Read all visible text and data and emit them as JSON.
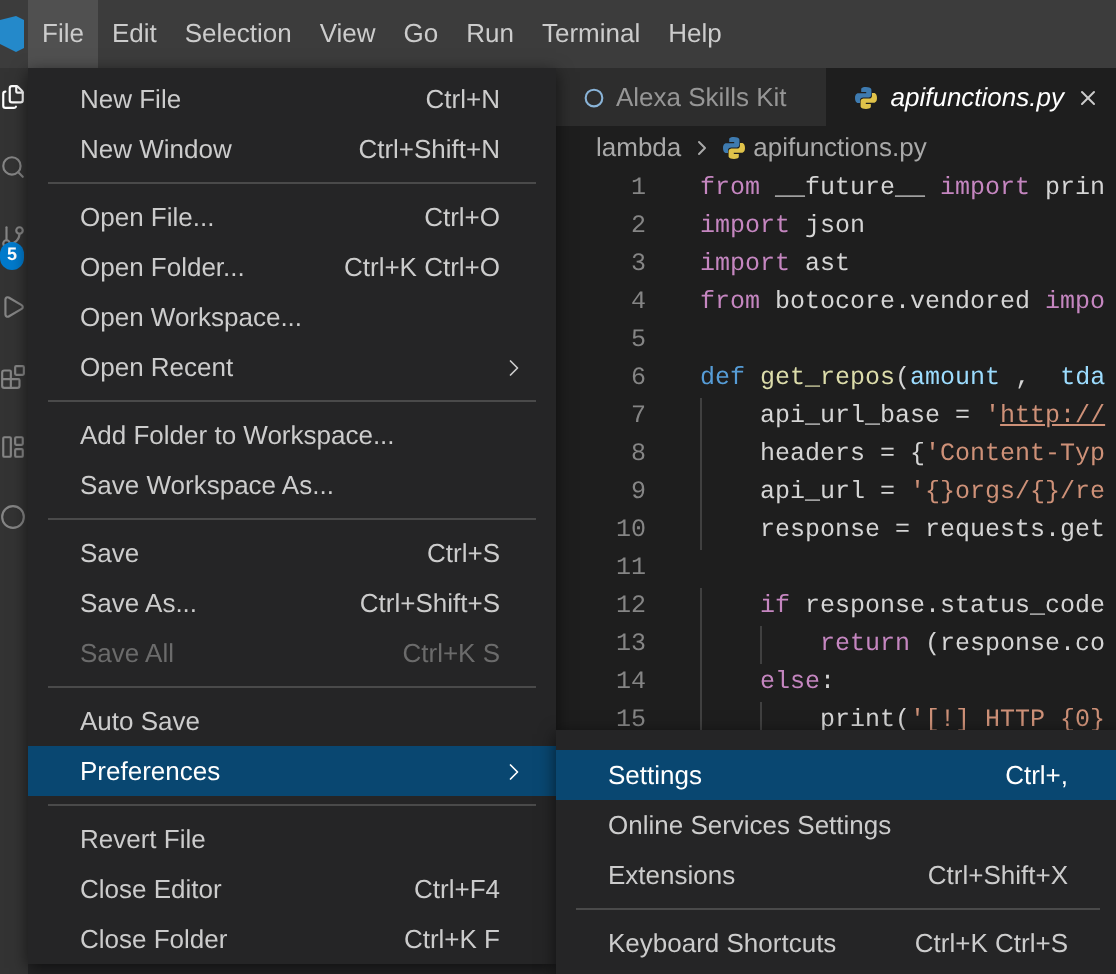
{
  "menubar": {
    "items": [
      {
        "label": "File",
        "selected": true
      },
      {
        "label": "Edit",
        "selected": false
      },
      {
        "label": "Selection",
        "selected": false
      },
      {
        "label": "View",
        "selected": false
      },
      {
        "label": "Go",
        "selected": false
      },
      {
        "label": "Run",
        "selected": false
      },
      {
        "label": "Terminal",
        "selected": false
      },
      {
        "label": "Help",
        "selected": false
      }
    ]
  },
  "activity_bar": {
    "badge": "5"
  },
  "file_menu": {
    "items": [
      {
        "kind": "item",
        "label": "New File",
        "shortcut": "Ctrl+N",
        "disabled": false,
        "selected": false
      },
      {
        "kind": "item",
        "label": "New Window",
        "shortcut": "Ctrl+Shift+N",
        "disabled": false,
        "selected": false
      },
      {
        "kind": "separator"
      },
      {
        "kind": "item",
        "label": "Open File...",
        "shortcut": "Ctrl+O",
        "disabled": false,
        "selected": false
      },
      {
        "kind": "item",
        "label": "Open Folder...",
        "shortcut": "Ctrl+K Ctrl+O",
        "disabled": false,
        "selected": false
      },
      {
        "kind": "item",
        "label": "Open Workspace...",
        "disabled": false,
        "selected": false
      },
      {
        "kind": "submenu",
        "label": "Open Recent",
        "disabled": false,
        "selected": false
      },
      {
        "kind": "separator"
      },
      {
        "kind": "item",
        "label": "Add Folder to Workspace...",
        "disabled": false,
        "selected": false
      },
      {
        "kind": "item",
        "label": "Save Workspace As...",
        "disabled": false,
        "selected": false
      },
      {
        "kind": "separator"
      },
      {
        "kind": "item",
        "label": "Save",
        "shortcut": "Ctrl+S",
        "disabled": false,
        "selected": false
      },
      {
        "kind": "item",
        "label": "Save As...",
        "shortcut": "Ctrl+Shift+S",
        "disabled": false,
        "selected": false
      },
      {
        "kind": "item",
        "label": "Save All",
        "shortcut": "Ctrl+K S",
        "disabled": true,
        "selected": false
      },
      {
        "kind": "separator"
      },
      {
        "kind": "item",
        "label": "Auto Save",
        "disabled": false,
        "selected": false
      },
      {
        "kind": "submenu",
        "label": "Preferences",
        "disabled": false,
        "selected": true
      },
      {
        "kind": "separator"
      },
      {
        "kind": "item",
        "label": "Revert File",
        "disabled": false,
        "selected": false
      },
      {
        "kind": "item",
        "label": "Close Editor",
        "shortcut": "Ctrl+F4",
        "disabled": false,
        "selected": false
      },
      {
        "kind": "item",
        "label": "Close Folder",
        "shortcut": "Ctrl+K F",
        "disabled": false,
        "selected": false
      }
    ]
  },
  "preferences_submenu": {
    "items": [
      {
        "kind": "item",
        "label": "Settings",
        "shortcut": "Ctrl+,",
        "disabled": false,
        "selected": true
      },
      {
        "kind": "item",
        "label": "Online Services Settings",
        "disabled": false,
        "selected": false
      },
      {
        "kind": "item",
        "label": "Extensions",
        "shortcut": "Ctrl+Shift+X",
        "disabled": false,
        "selected": false
      },
      {
        "kind": "separator"
      },
      {
        "kind": "item",
        "label": "Keyboard Shortcuts",
        "shortcut": "Ctrl+K Ctrl+S",
        "disabled": false,
        "selected": false
      }
    ]
  },
  "tabs": [
    {
      "kind": "extension",
      "label": "Alexa Skills Kit",
      "selected": false
    },
    {
      "kind": "file",
      "label": "apifunctions.py",
      "selected": true
    }
  ],
  "breadcrumb": {
    "folder": "lambda",
    "file": "apifunctions.py"
  },
  "code": {
    "lines": [
      {
        "number": "1",
        "tokens": [
          {
            "kind": "keyword",
            "text": "from"
          },
          {
            "kind": "plain",
            "text": " __future__ "
          },
          {
            "kind": "keyword",
            "text": "import"
          },
          {
            "kind": "plain",
            "text": " prin"
          }
        ]
      },
      {
        "number": "2",
        "tokens": [
          {
            "kind": "keyword",
            "text": "import"
          },
          {
            "kind": "plain",
            "text": " json"
          }
        ]
      },
      {
        "number": "3",
        "tokens": [
          {
            "kind": "keyword",
            "text": "import"
          },
          {
            "kind": "plain",
            "text": " ast"
          }
        ]
      },
      {
        "number": "4",
        "tokens": [
          {
            "kind": "keyword",
            "text": "from"
          },
          {
            "kind": "plain",
            "text": " botocore.vendored "
          },
          {
            "kind": "keyword",
            "text": "impo"
          }
        ]
      },
      {
        "number": "5"
      },
      {
        "number": "6",
        "tokens": [
          {
            "kind": "storage",
            "text": "def"
          },
          {
            "kind": "function",
            "text": " get_repos"
          },
          {
            "kind": "plain",
            "text": "("
          },
          {
            "kind": "param",
            "text": "amount"
          },
          {
            "kind": "plain",
            "text": " ,  "
          },
          {
            "kind": "param",
            "text": "tda"
          }
        ]
      },
      {
        "number": "7",
        "tokens": [
          {
            "kind": "plain",
            "text": "    api_url_base = "
          },
          {
            "kind": "string",
            "text": "'"
          },
          {
            "kind": "link",
            "text": "http://"
          }
        ]
      },
      {
        "number": "8",
        "tokens": [
          {
            "kind": "plain",
            "text": "    headers = {"
          },
          {
            "kind": "string",
            "text": "'Content-Typ"
          }
        ]
      },
      {
        "number": "9",
        "tokens": [
          {
            "kind": "plain",
            "text": "    api_url = "
          },
          {
            "kind": "string",
            "text": "'{}orgs/{}/re"
          }
        ]
      },
      {
        "number": "10",
        "tokens": [
          {
            "kind": "plain",
            "text": "    response = requests.get"
          }
        ]
      },
      {
        "number": "11"
      },
      {
        "number": "12",
        "tokens": [
          {
            "kind": "keyword",
            "text": "    if"
          },
          {
            "kind": "plain",
            "text": " response.status_code"
          }
        ]
      },
      {
        "number": "13",
        "tokens": [
          {
            "kind": "keyword",
            "text": "        return"
          },
          {
            "kind": "plain",
            "text": " (response.co"
          }
        ]
      },
      {
        "number": "14",
        "tokens": [
          {
            "kind": "keyword",
            "text": "    else"
          },
          {
            "kind": "plain",
            "text": ":"
          }
        ]
      },
      {
        "number": "15",
        "tokens": [
          {
            "kind": "plain",
            "text": "        print("
          },
          {
            "kind": "string",
            "text": "'[!] HTTP {0}"
          }
        ]
      }
    ]
  }
}
